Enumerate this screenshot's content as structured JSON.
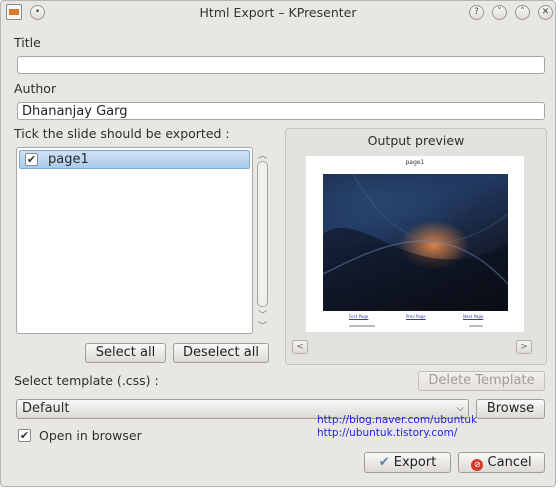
{
  "window": {
    "title": "Html Export – KPresenter"
  },
  "title_field": {
    "label": "Title",
    "value": ""
  },
  "author_field": {
    "label": "Author",
    "value": "Dhananjay Garg"
  },
  "slides": {
    "label": "Tick the slide should be exported :",
    "items": [
      {
        "label": "page1",
        "checked": true
      }
    ]
  },
  "buttons": {
    "select_all": "Select all",
    "deselect_all": "Deselect all",
    "delete_template": "Delete Template",
    "browse": "Browse",
    "export": "Export",
    "cancel": "Cancel"
  },
  "preview": {
    "label": "Output preview",
    "page_title": "page1",
    "links": [
      "First Page",
      "Prev Page",
      "Next Page"
    ]
  },
  "template": {
    "label": "Select template (.css) :",
    "selected": "Default"
  },
  "open_in_browser": {
    "label": "Open in browser",
    "checked": true
  },
  "watermark": {
    "line1": "http://blog.naver.com/ubuntuk",
    "line2": "http://ubuntuk.tistory.com/"
  }
}
